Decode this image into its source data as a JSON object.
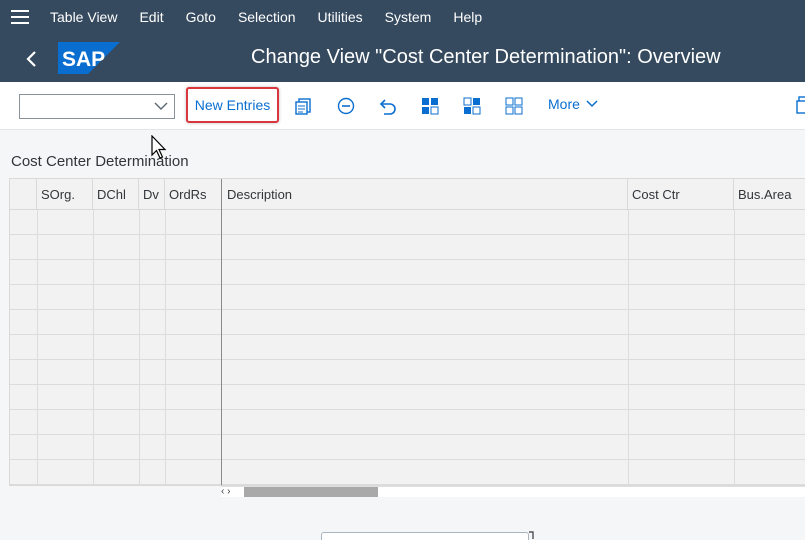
{
  "menu": {
    "hamburger_icon": "hamburger-menu-icon",
    "items": [
      {
        "label": "Table View"
      },
      {
        "label": "Edit"
      },
      {
        "label": "Goto"
      },
      {
        "label": "Selection"
      },
      {
        "label": "Utilities"
      },
      {
        "label": "System"
      },
      {
        "label": "Help"
      }
    ]
  },
  "header": {
    "back_icon": "chevron-left-icon",
    "logo_text": "SAP",
    "title": "Change View \"Cost Center Determination\": Overview",
    "brand_color": "#354a5f",
    "logo_color": "#0a6ed1"
  },
  "toolbar": {
    "variant_value": "",
    "new_entries_label": "New Entries",
    "icons": [
      "copy-icon",
      "delete-icon",
      "undo-icon",
      "select-all-icon",
      "select-block-icon",
      "deselect-all-icon"
    ],
    "more_label": "More",
    "highlight_color": "#d9363e"
  },
  "section": {
    "title": "Cost Center Determination"
  },
  "table": {
    "columns": [
      {
        "label": ""
      },
      {
        "label": "SOrg."
      },
      {
        "label": "DChl"
      },
      {
        "label": "Dv"
      },
      {
        "label": "OrdRs"
      },
      {
        "label": "Description"
      },
      {
        "label": "Cost Ctr"
      },
      {
        "label": "Bus.Area"
      }
    ],
    "rows": [
      [],
      [],
      [],
      [],
      [],
      [],
      [],
      [],
      [],
      [],
      []
    ],
    "scroll_arrows": "‹ ›"
  }
}
